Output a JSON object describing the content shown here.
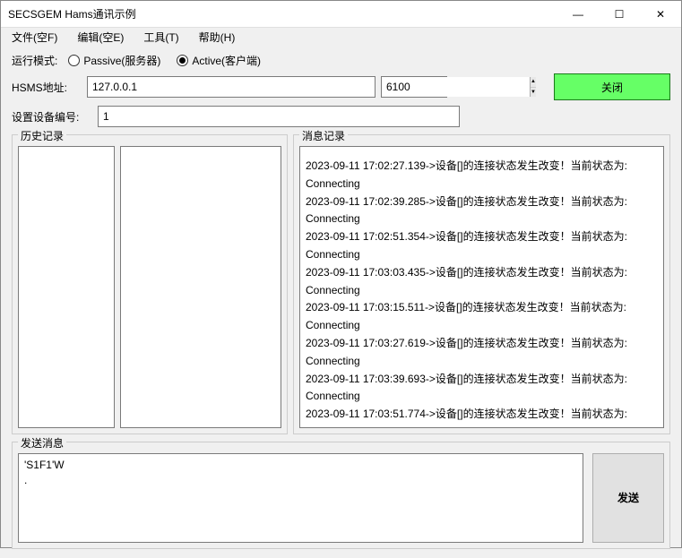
{
  "window": {
    "title": "SECSGEM Hams通讯示例"
  },
  "menu": {
    "file": "文件(空F)",
    "edit": "编辑(空E)",
    "tools": "工具(T)",
    "help": "帮助(H)"
  },
  "mode": {
    "label": "运行模式:",
    "passive": {
      "label": "Passive(服务器)",
      "checked": false
    },
    "active": {
      "label": "Active(客户端)",
      "checked": true
    }
  },
  "hsms": {
    "label": "HSMS地址:",
    "address": "127.0.0.1",
    "port": "6100"
  },
  "close_button": "关闭",
  "device": {
    "label": "设置设备编号:",
    "value": "1"
  },
  "history": {
    "legend": "历史记录"
  },
  "messages": {
    "legend": "消息记录",
    "lines": [
      "2023-09-11 17:02:27.139->设备[]的连接状态发生改变！当前状态为:",
      "Connecting",
      "2023-09-11 17:02:39.285->设备[]的连接状态发生改变！当前状态为:",
      "Connecting",
      "2023-09-11 17:02:51.354->设备[]的连接状态发生改变！当前状态为:",
      "Connecting",
      "2023-09-11 17:03:03.435->设备[]的连接状态发生改变！当前状态为:",
      "Connecting",
      "2023-09-11 17:03:15.511->设备[]的连接状态发生改变！当前状态为:",
      "Connecting",
      "2023-09-11 17:03:27.619->设备[]的连接状态发生改变！当前状态为:",
      "Connecting",
      "2023-09-11 17:03:39.693->设备[]的连接状态发生改变！当前状态为:",
      "Connecting",
      "2023-09-11 17:03:51.774->设备[]的连接状态发生改变！当前状态为:"
    ]
  },
  "send": {
    "legend": "发送消息",
    "text_line1": "'S1F1'W",
    "text_line2": ".",
    "button": "发送"
  }
}
